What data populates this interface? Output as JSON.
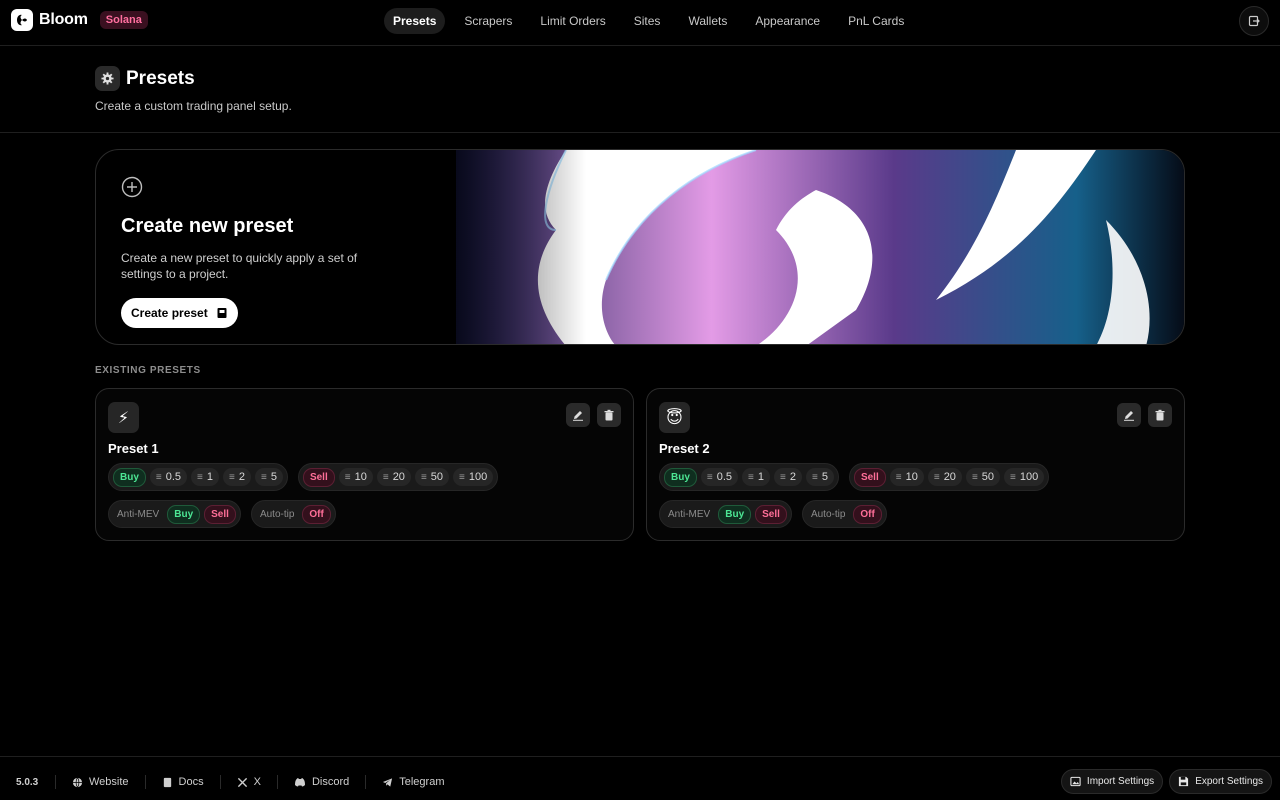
{
  "app": {
    "name": "Bloom",
    "chain": "Solana"
  },
  "nav": {
    "items": [
      {
        "label": "Presets",
        "active": true
      },
      {
        "label": "Scrapers"
      },
      {
        "label": "Limit Orders"
      },
      {
        "label": "Sites"
      },
      {
        "label": "Wallets"
      },
      {
        "label": "Appearance"
      },
      {
        "label": "PnL Cards"
      }
    ]
  },
  "header": {
    "title": "Presets",
    "subtitle": "Create a custom trading panel setup."
  },
  "hero": {
    "title": "Create new preset",
    "description": "Create a new preset to quickly apply a set of settings to a project.",
    "button_label": "Create preset"
  },
  "section_label": "EXISTING PRESETS",
  "presets": [
    {
      "emoji": "⚡",
      "name": "Preset 1",
      "buy_label": "Buy",
      "buy_amounts": [
        "0.5",
        "1",
        "2",
        "5"
      ],
      "sell_label": "Sell",
      "sell_amounts": [
        "10",
        "20",
        "50",
        "100"
      ],
      "anti_mev_label": "Anti-MEV",
      "anti_mev_buy": "Buy",
      "anti_mev_sell": "Sell",
      "auto_tip_label": "Auto-tip",
      "auto_tip_value": "Off"
    },
    {
      "emoji": "😇",
      "name": "Preset 2",
      "buy_label": "Buy",
      "buy_amounts": [
        "0.5",
        "1",
        "2",
        "5"
      ],
      "sell_label": "Sell",
      "sell_amounts": [
        "10",
        "20",
        "50",
        "100"
      ],
      "anti_mev_label": "Anti-MEV",
      "anti_mev_buy": "Buy",
      "anti_mev_sell": "Sell",
      "auto_tip_label": "Auto-tip",
      "auto_tip_value": "Off"
    }
  ],
  "footer": {
    "version": "5.0.3",
    "links": [
      {
        "label": "Website",
        "icon": "globe-icon"
      },
      {
        "label": "Docs",
        "icon": "book-icon"
      },
      {
        "label": "X",
        "icon": "x-icon"
      },
      {
        "label": "Discord",
        "icon": "discord-icon"
      },
      {
        "label": "Telegram",
        "icon": "telegram-icon"
      }
    ],
    "import_label": "Import Settings",
    "export_label": "Export Settings"
  },
  "colors": {
    "buy": "#4ce694",
    "sell": "#ff6f98",
    "badge": "#ff6f9f"
  }
}
